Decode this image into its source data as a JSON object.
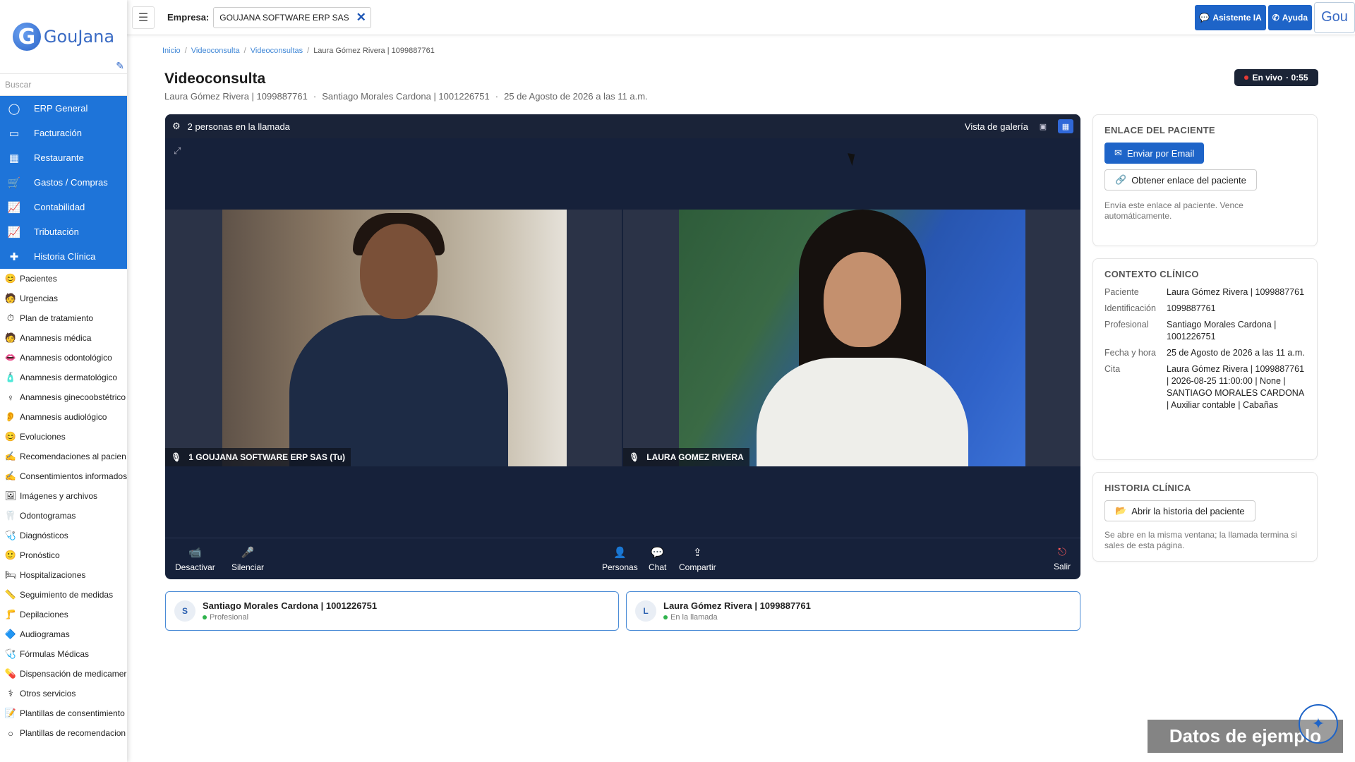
{
  "sidebar": {
    "logo_text": "GouJana",
    "search_placeholder": "Buscar",
    "main_items": [
      {
        "label": "ERP General",
        "icon": "circle-icon"
      },
      {
        "label": "Facturación",
        "icon": "card-icon"
      },
      {
        "label": "Restaurante",
        "icon": "calendar-icon"
      },
      {
        "label": "Gastos / Compras",
        "icon": "cart-icon"
      },
      {
        "label": "Contabilidad",
        "icon": "chart-icon"
      },
      {
        "label": "Tributación",
        "icon": "chart-icon"
      },
      {
        "label": "Historia Clínica",
        "icon": "plus-icon"
      }
    ],
    "sub_items": [
      "Pacientes",
      "Urgencias",
      "Plan de tratamiento",
      "Anamnesis médica",
      "Anamnesis odontológico",
      "Anamnesis dermatológico",
      "Anamnesis ginecoobstétrico",
      "Anamnesis audiológico",
      "Evoluciones",
      "Recomendaciones al pacien",
      "Consentimientos informados",
      "Imágenes y archivos",
      "Odontogramas",
      "Diagnósticos",
      "Pronóstico",
      "Hospitalizaciones",
      "Seguimiento de medidas",
      "Depilaciones",
      "Audiogramas",
      "Fórmulas Médicas",
      "Dispensación de medicamer",
      "Otros servicios",
      "Plantillas de consentimiento",
      "Plantillas de recomendacion"
    ]
  },
  "topbar": {
    "empresa_label": "Empresa:",
    "empresa_value": "GOUJANA SOFTWARE ERP SAS",
    "asistente_label": "Asistente IA",
    "ayuda_label": "Ayuda",
    "gou_label": "Gou"
  },
  "breadcrumb": [
    "Inicio",
    "Videoconsulta",
    "Videoconsultas",
    "Laura Gómez Rivera | 1099887761"
  ],
  "page": {
    "title": "Videoconsulta",
    "patient": "Laura Gómez Rivera | 1099887761",
    "professional": "Santiago Morales Cardona | 1001226751",
    "datetime": "25 de Agosto de 2026 a las 11 a.m.",
    "live_label": "En vivo",
    "live_time": "· 0:55"
  },
  "video": {
    "people_count": "2 personas en la llamada",
    "view_label": "Vista de galería",
    "tile1_label": "1 GOUJANA SOFTWARE ERP SAS (Tu)",
    "tile2_label": "LAURA GOMEZ RIVERA",
    "controls": {
      "camera": "Desactivar",
      "mute": "Silenciar",
      "people": "Personas",
      "chat": "Chat",
      "share": "Compartir",
      "leave": "Salir"
    }
  },
  "participants": [
    {
      "initial": "S",
      "name": "Santiago Morales Cardona | 1001226751",
      "status": "Profesional"
    },
    {
      "initial": "L",
      "name": "Laura Gómez Rivera | 1099887761",
      "status": "En la llamada"
    }
  ],
  "link_card": {
    "title": "ENLACE DEL PACIENTE",
    "email_btn": "Enviar por Email",
    "link_btn": "Obtener enlace del paciente",
    "note": "Envía este enlace al paciente. Vence automáticamente."
  },
  "context_card": {
    "title": "CONTEXTO CLÍNICO",
    "rows": [
      {
        "k": "Paciente",
        "v": "Laura Gómez Rivera | 1099887761"
      },
      {
        "k": "Identificación",
        "v": "1099887761"
      },
      {
        "k": "Profesional",
        "v": "Santiago Morales Cardona | 1001226751"
      },
      {
        "k": "Fecha y hora",
        "v": "25 de Agosto de 2026 a las 11 a.m."
      },
      {
        "k": "Cita",
        "v": "Laura Gómez Rivera | 1099887761 | 2026-08-25 11:00:00 | None | SANTIAGO MORALES CARDONA | Auxiliar contable | Cabañas"
      }
    ]
  },
  "history_card": {
    "title": "HISTORIA CLÍNICA",
    "open_btn": "Abrir la historia del paciente",
    "note": "Se abre en la misma ventana; la llamada termina si sales de esta página."
  },
  "watermark": "Datos de ejemplo",
  "colors": {
    "primary": "#1e64c8",
    "sidebar_active": "#1e74d9",
    "video_bg": "#16213a",
    "live_dot": "#e53935",
    "online": "#2fb34c"
  }
}
